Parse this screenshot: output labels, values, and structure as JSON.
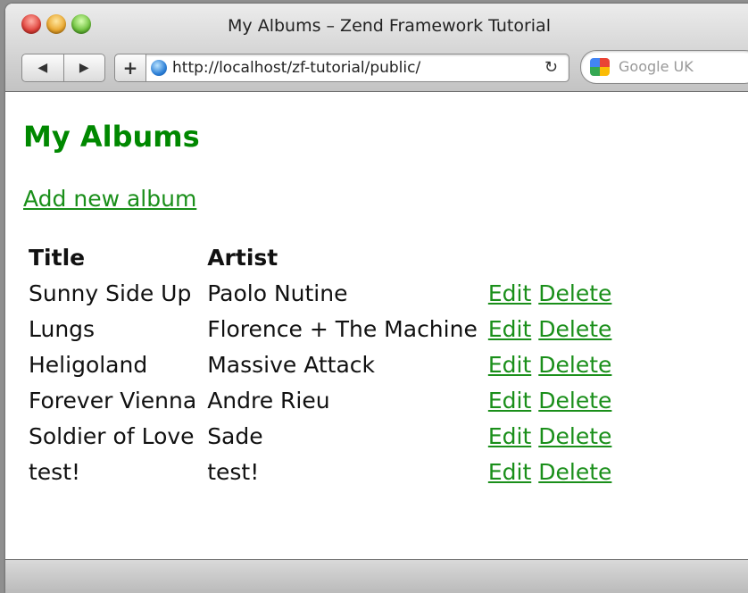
{
  "window": {
    "title": "My Albums – Zend Framework Tutorial"
  },
  "toolbar": {
    "back_icon": "back-arrow-icon",
    "forward_icon": "forward-arrow-icon",
    "add_bookmark": "+",
    "url": "http://localhost/zf-tutorial/public/",
    "reload": "↻",
    "search_placeholder": "Google UK"
  },
  "page": {
    "heading": "My Albums",
    "add_link": "Add new album",
    "columns": [
      "Title",
      "Artist"
    ],
    "rows": [
      {
        "title": "Sunny Side Up",
        "artist": "Paolo Nutine",
        "edit": "Edit",
        "delete": "Delete"
      },
      {
        "title": "Lungs",
        "artist": "Florence + The Machine",
        "edit": "Edit",
        "delete": "Delete"
      },
      {
        "title": "Heligoland",
        "artist": "Massive Attack",
        "edit": "Edit",
        "delete": "Delete"
      },
      {
        "title": "Forever Vienna",
        "artist": "Andre Rieu",
        "edit": "Edit",
        "delete": "Delete"
      },
      {
        "title": "Soldier of Love",
        "artist": "Sade",
        "edit": "Edit",
        "delete": "Delete"
      },
      {
        "title": "test!",
        "artist": "test!",
        "edit": "Edit",
        "delete": "Delete"
      }
    ]
  },
  "colors": {
    "heading": "#008800",
    "link": "#1a8f1a"
  }
}
